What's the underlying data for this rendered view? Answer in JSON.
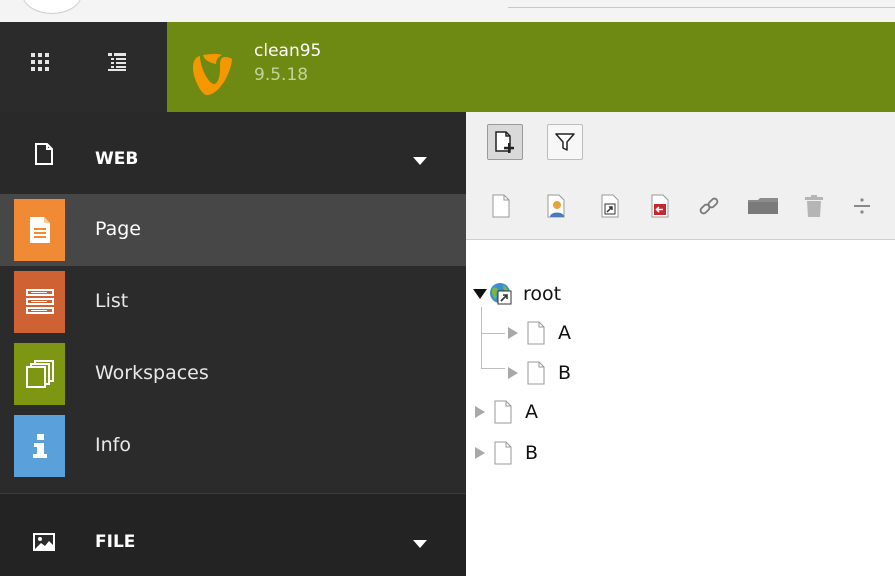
{
  "header": {
    "site_name": "clean95",
    "site_version": "9.5.18",
    "brand_color": "#6f8a13",
    "logo_color": "#f49700",
    "app_menu_icon": "grid-icon",
    "list_menu_icon": "list-icon"
  },
  "sidebar": {
    "groups": [
      {
        "label": "WEB",
        "icon": "page-outline-icon",
        "items": [
          {
            "label": "Page",
            "icon": "page-module-icon",
            "color": "#f18a34",
            "active": true
          },
          {
            "label": "List",
            "icon": "list-module-icon",
            "color": "#cf6233",
            "active": false
          },
          {
            "label": "Workspaces",
            "icon": "workspaces-module-icon",
            "color": "#7d9713",
            "active": false
          },
          {
            "label": "Info",
            "icon": "info-module-icon",
            "color": "#5aa0db",
            "active": false
          }
        ]
      },
      {
        "label": "FILE",
        "icon": "image-icon",
        "items": []
      }
    ]
  },
  "toolbar": {
    "buttons": [
      "new-page-icon",
      "filter-icon"
    ],
    "drag_icons": [
      "page-icon",
      "backend-user-section-icon",
      "shortcut-icon",
      "mountpoint-icon",
      "link-icon",
      "folder-icon",
      "recycler-icon",
      "divider-icon"
    ]
  },
  "tree": {
    "nodes": [
      {
        "label": "root",
        "depth": 0,
        "expanded": true
      },
      {
        "label": "A",
        "depth": 1,
        "expanded": false
      },
      {
        "label": "B",
        "depth": 1,
        "expanded": false
      },
      {
        "label": "A",
        "depth": 0,
        "expanded": false
      },
      {
        "label": "B",
        "depth": 0,
        "expanded": false
      }
    ]
  }
}
